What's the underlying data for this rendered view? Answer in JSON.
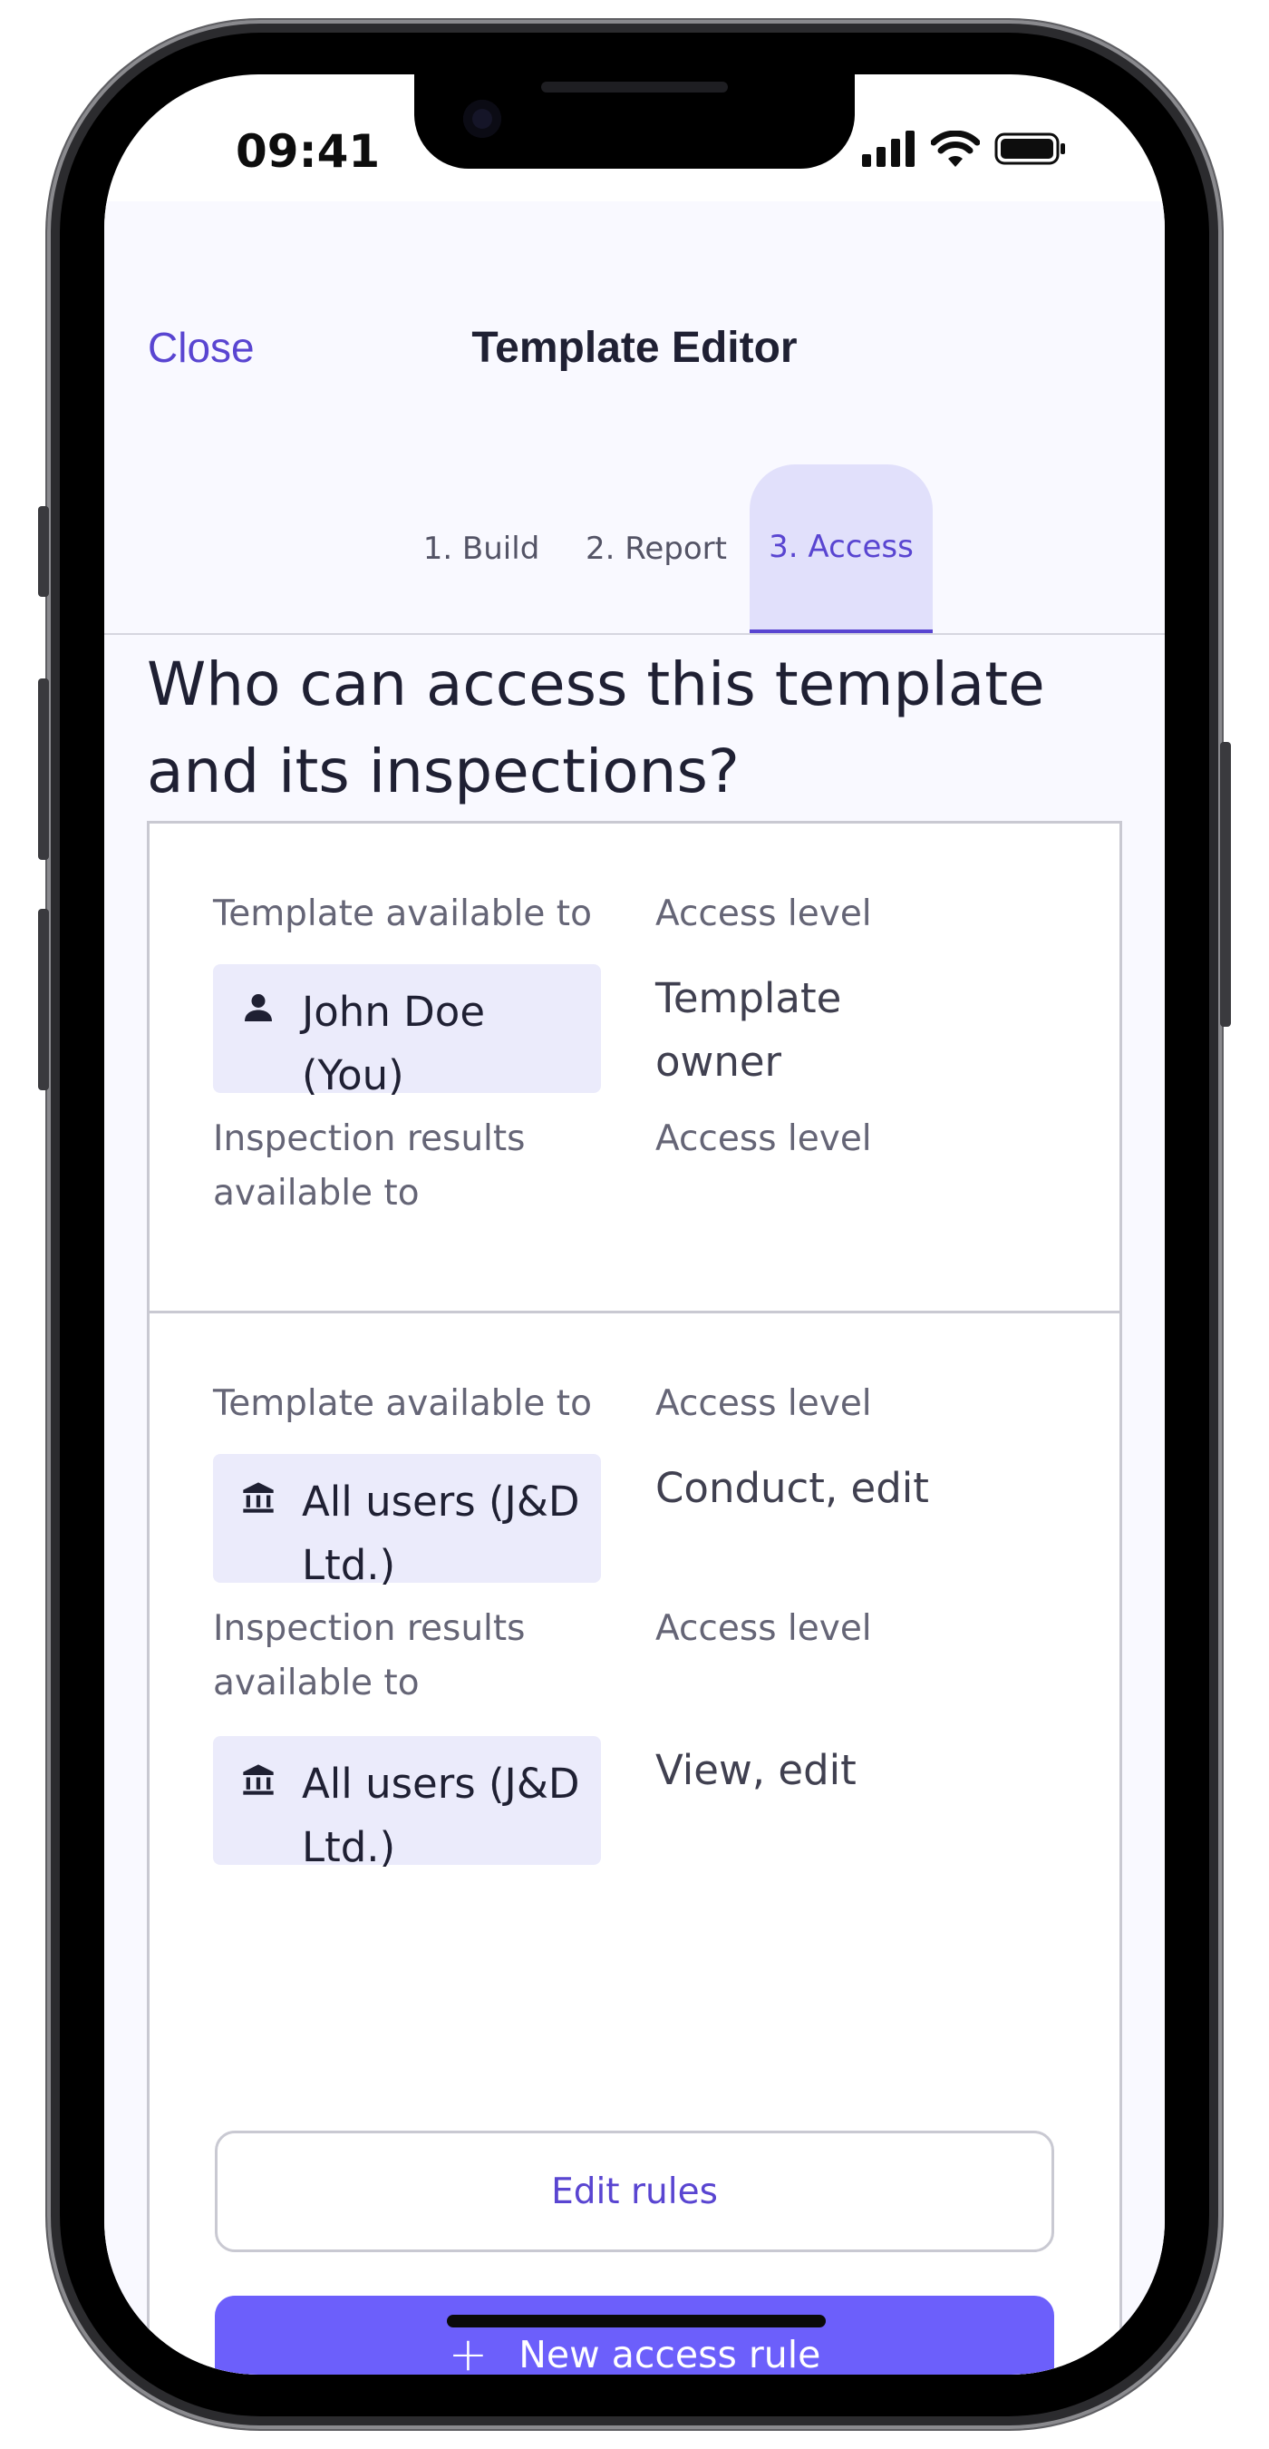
{
  "status": {
    "time": "09:41"
  },
  "nav": {
    "close_label": "Close",
    "title": "Template Editor"
  },
  "tabs": [
    {
      "label": "1. Build"
    },
    {
      "label": "2. Report"
    },
    {
      "label": "3. Access"
    }
  ],
  "heading_line1": "Who can access this template",
  "heading_line2": "and its inspections?",
  "rules": [
    {
      "template_label": "Template available to",
      "access_label": "Access level",
      "template_chip": {
        "icon": "person-icon",
        "line1": "John Doe",
        "line2": "(You)"
      },
      "template_access": {
        "line1": "Template",
        "line2": "owner"
      },
      "results_label_line1": "Inspection results",
      "results_label_line2": "available to",
      "results_access_label": "Access level"
    },
    {
      "template_label": "Template available to",
      "access_label": "Access level",
      "template_chip": {
        "icon": "bank-icon",
        "line1": "All users (J&D",
        "line2": "Ltd.)"
      },
      "template_access": {
        "line1": "Conduct, edit"
      },
      "results_label_line1": "Inspection results",
      "results_label_line2": "available to",
      "results_access_label": "Access level",
      "results_chip": {
        "icon": "bank-icon",
        "line1": "All users (J&D",
        "line2": "Ltd.)"
      },
      "results_access": {
        "line1": "View, edit"
      }
    }
  ],
  "actions": {
    "edit_rules": "Edit rules",
    "new_access_rule": "New access rule"
  },
  "colors": {
    "accent": "#5945d1",
    "primary_button": "#6c5ffb",
    "chip": "#ebebfb",
    "active_tab": "#e1e0fb"
  }
}
